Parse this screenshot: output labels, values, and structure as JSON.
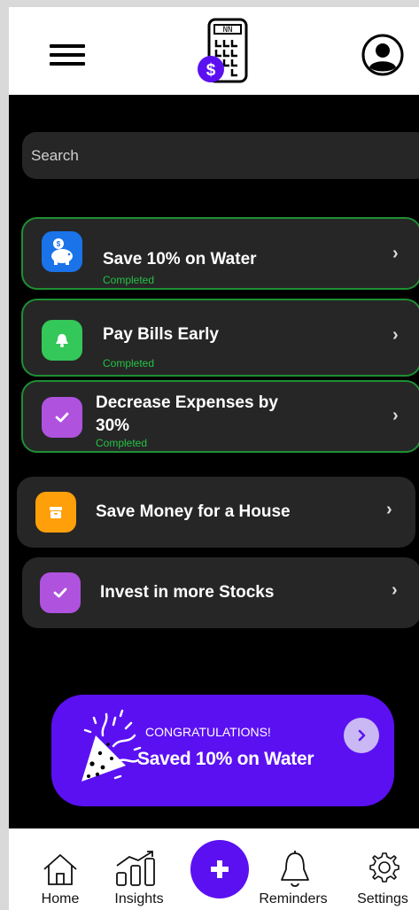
{
  "header": {
    "menu_icon": "hamburger-menu-icon",
    "logo_icon": "calculator-dollar-icon",
    "logo_badge": "$",
    "profile_icon": "user-circle-icon"
  },
  "search": {
    "placeholder": "Search"
  },
  "goals": [
    {
      "title": "Save 10% on Water",
      "status": "Completed",
      "icon": "piggy-bank-icon",
      "color": "#1a73e8",
      "completed": true
    },
    {
      "title": "Pay Bills Early",
      "status": "Completed",
      "icon": "bell-icon",
      "color": "#34c759",
      "completed": true
    },
    {
      "title": "Decrease Expenses by 30%",
      "title_line1": "Decrease Expenses by",
      "title_line2": "30%",
      "status": "Completed",
      "icon": "checkmark-icon",
      "color": "#af52de",
      "completed": true
    },
    {
      "title": "Save Money for a House",
      "icon": "archive-box-icon",
      "color": "#ff9f0a",
      "completed": false
    },
    {
      "title": "Invest in more Stocks",
      "icon": "checkmark-icon",
      "color": "#af52de",
      "completed": false
    }
  ],
  "congrats": {
    "label": "CONGRATULATIONS!",
    "value": "Saved 10% on Water",
    "icon": "party-popper-icon",
    "color": "#5b10f2"
  },
  "tabbar": {
    "home": "Home",
    "insights": "Insights",
    "add_icon": "plus-icon",
    "reminders": "Reminders",
    "settings": "Settings"
  }
}
